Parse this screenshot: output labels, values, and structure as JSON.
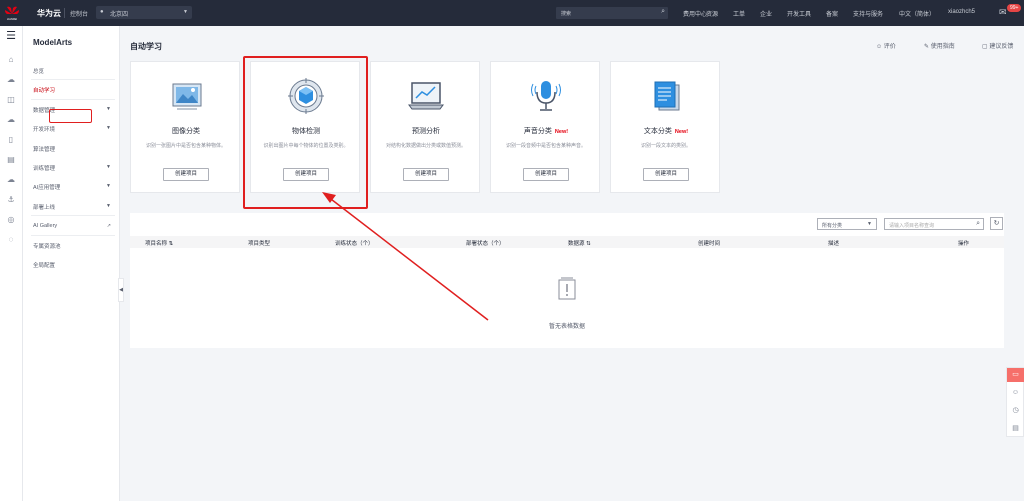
{
  "topbar": {
    "brand": "华为云",
    "logo_text": "HUAWEI",
    "console": "控制台",
    "region": "北京四",
    "search_placeholder": "搜索",
    "nav": [
      "费用中心",
      "资源",
      "工单",
      "企业",
      "开发工具",
      "备案",
      "支持与服务",
      "中文（简体）",
      "xiaozhch5"
    ],
    "badge": "99+"
  },
  "sidebar": {
    "title": "ModelArts",
    "items": [
      {
        "label": "总览"
      },
      {
        "label": "自动学习"
      },
      {
        "label": "数据管理"
      },
      {
        "label": "开发环境"
      },
      {
        "label": "算法管理"
      },
      {
        "label": "训练管理"
      },
      {
        "label": "AI应用管理"
      },
      {
        "label": "部署上线"
      },
      {
        "label": "AI Gallery"
      },
      {
        "label": "专属资源池"
      },
      {
        "label": "全局配置"
      }
    ]
  },
  "main": {
    "title": "自动学习",
    "links": {
      "rate": "评价",
      "guide": "使用指南",
      "feedback": "建议反馈"
    },
    "cards": [
      {
        "name": "图像分类",
        "desc": "识别一张图片中是否包含某种物体。",
        "button": "创建项目",
        "icon": "image-classification-icon",
        "new": ""
      },
      {
        "name": "物体检测",
        "desc": "识别出图片中每个物体的位置及类别。",
        "button": "创建项目",
        "icon": "object-detection-icon",
        "new": ""
      },
      {
        "name": "预测分析",
        "desc": "对结构化数据做出分类或数值预测。",
        "button": "创建项目",
        "icon": "predictive-analysis-icon",
        "new": ""
      },
      {
        "name": "声音分类",
        "desc": "识别一段音频中是否包含某种声音。",
        "button": "创建项目",
        "icon": "sound-classification-icon",
        "new": "New!"
      },
      {
        "name": "文本分类",
        "desc": "识别一段文本的类别。",
        "button": "创建项目",
        "icon": "text-classification-icon",
        "new": "New!"
      }
    ],
    "table": {
      "filter": "所有分类",
      "search_placeholder": "请输入项目名称查询",
      "columns": [
        "项目名称",
        "项目类型",
        "训练状态（个）",
        "部署状态（个）",
        "数据源",
        "创建时间",
        "描述",
        "操作"
      ],
      "empty": "暂无表格数据"
    }
  },
  "colors": {
    "accent": "#c7000b",
    "topbar": "#252b3a",
    "annotation": "#e01f1f"
  }
}
